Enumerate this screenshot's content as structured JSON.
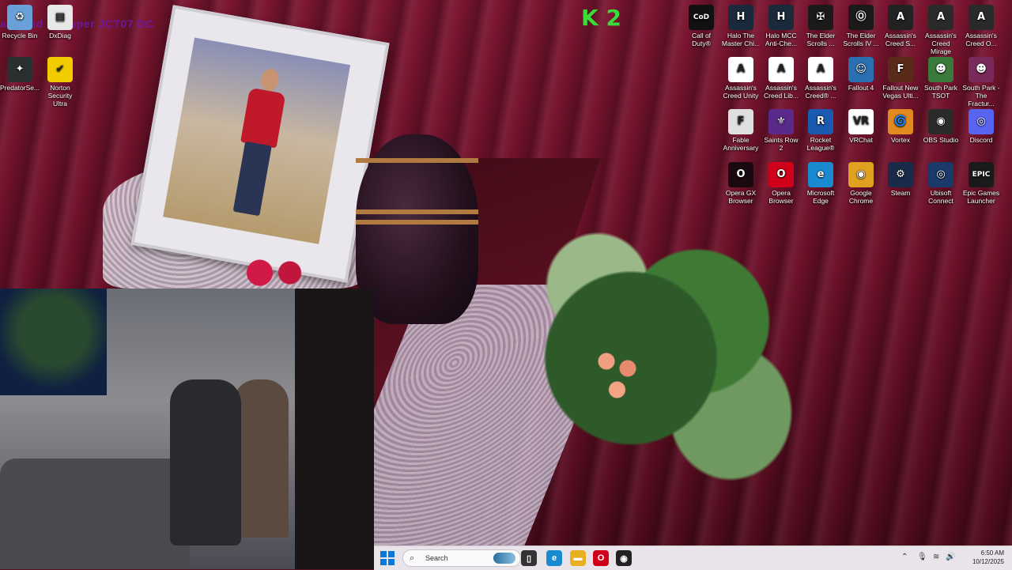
{
  "overlay_text": "allowed to Super JCT07 DC",
  "stream_logo": "K 2",
  "desktop_left_icons": [
    {
      "label": "Recycle Bin",
      "icon": "recycle-bin-icon",
      "color": "#6aa0d8",
      "glyph": "♻"
    },
    {
      "label": "DxDiag",
      "icon": "document-icon",
      "color": "#e8e8e8",
      "glyph": "▤"
    },
    {
      "label": "PredatorSe...",
      "icon": "predator-sense-icon",
      "color": "#2a3030",
      "glyph": "✦"
    },
    {
      "label": "Norton Security Ultra",
      "icon": "norton-icon",
      "color": "#f2cc00",
      "glyph": "✔"
    }
  ],
  "desktop_right_icons": [
    {
      "label": "Call of Duty®",
      "icon": "call-of-duty-icon",
      "color": "#111111",
      "glyph": "CoD"
    },
    {
      "label": "Halo The Master Chi...",
      "icon": "halo-mcc-icon",
      "color": "#1a2a3a",
      "glyph": "H"
    },
    {
      "label": "Halo MCC Anti-Che...",
      "icon": "halo-anticheat-icon",
      "color": "#1a2a3a",
      "glyph": "H"
    },
    {
      "label": "The Elder Scrolls ...",
      "icon": "elder-scrolls-icon",
      "color": "#1a1a1a",
      "glyph": "✠"
    },
    {
      "label": "The Elder Scrolls IV ...",
      "icon": "oblivion-icon",
      "color": "#1a1a1a",
      "glyph": "Ⓞ"
    },
    {
      "label": "Assassin's Creed S...",
      "icon": "assassins-creed-icon",
      "color": "#222222",
      "glyph": "A"
    },
    {
      "label": "Assassin's Creed Mirage",
      "icon": "ac-mirage-icon",
      "color": "#2a2a2a",
      "glyph": "A"
    },
    {
      "label": "Assassin's Creed O...",
      "icon": "ac-origins-icon",
      "color": "#2a2a2a",
      "glyph": "A"
    },
    {
      "label": "Assassin's Creed Unity",
      "icon": "ac-unity-icon",
      "color": "#ffffff",
      "glyph": "A"
    },
    {
      "label": "Assassin's Creed Lib...",
      "icon": "ac-liberation-icon",
      "color": "#ffffff",
      "glyph": "A"
    },
    {
      "label": "Assassin's Creed® ...",
      "icon": "ac-generic-icon",
      "color": "#ffffff",
      "glyph": "A"
    },
    {
      "label": "Fallout 4",
      "icon": "fallout4-icon",
      "color": "#2a6fb0",
      "glyph": "☺"
    },
    {
      "label": "Fallout New Vegas Ulti...",
      "icon": "fallout-nv-icon",
      "color": "#5a2a1a",
      "glyph": "F"
    },
    {
      "label": "South Park TSOT",
      "icon": "south-park-icon",
      "color": "#3a7a3a",
      "glyph": "☻"
    },
    {
      "label": "South Park - The Fractur...",
      "icon": "south-park-fbw-icon",
      "color": "#7a2a5a",
      "glyph": "☻"
    },
    {
      "label": "Fable Anniversary",
      "icon": "fable-icon",
      "color": "#e0e0e0",
      "glyph": "F"
    },
    {
      "label": "Saints Row 2",
      "icon": "saints-row-icon",
      "color": "#5a2a8a",
      "glyph": "⚜"
    },
    {
      "label": "Rocket League®",
      "icon": "rocket-league-icon",
      "color": "#1a5ab0",
      "glyph": "R"
    },
    {
      "label": "VRChat",
      "icon": "vrchat-icon",
      "color": "#ffffff",
      "glyph": "VR"
    },
    {
      "label": "Vortex",
      "icon": "vortex-icon",
      "color": "#e08a20",
      "glyph": "🌀"
    },
    {
      "label": "OBS Studio",
      "icon": "obs-icon",
      "color": "#2a2a2a",
      "glyph": "◉"
    },
    {
      "label": "Discord",
      "icon": "discord-icon",
      "color": "#5865f2",
      "glyph": "◎"
    },
    {
      "label": "Opera GX Browser",
      "icon": "opera-gx-icon",
      "color": "#1a0a0f",
      "glyph": "O"
    },
    {
      "label": "Opera Browser",
      "icon": "opera-icon",
      "color": "#d0001a",
      "glyph": "O"
    },
    {
      "label": "Microsoft Edge",
      "icon": "edge-icon",
      "color": "#1a8ad0",
      "glyph": "e"
    },
    {
      "label": "Google Chrome",
      "icon": "chrome-icon",
      "color": "#e0a020",
      "glyph": "◉"
    },
    {
      "label": "Steam",
      "icon": "steam-icon",
      "color": "#1a2a4a",
      "glyph": "⚙"
    },
    {
      "label": "Ubisoft Connect",
      "icon": "ubisoft-icon",
      "color": "#1a3a6a",
      "glyph": "◎"
    },
    {
      "label": "Epic Games Launcher",
      "icon": "epic-games-icon",
      "color": "#1a1a1a",
      "glyph": "EPIC"
    }
  ],
  "taskbar": {
    "search_placeholder": "Search",
    "apps": [
      {
        "name": "task-view-icon",
        "glyph": "▯",
        "color": "#333333"
      },
      {
        "name": "edge-taskbar-icon",
        "glyph": "e",
        "color": "#1a8ad0"
      },
      {
        "name": "file-explorer-icon",
        "glyph": "▬",
        "color": "#e8b020"
      },
      {
        "name": "opera-taskbar-icon",
        "glyph": "O",
        "color": "#d0001a"
      },
      {
        "name": "obs-taskbar-icon",
        "glyph": "◉",
        "color": "#222222"
      }
    ],
    "time": "6:50 AM",
    "date": "10/12/2025"
  }
}
